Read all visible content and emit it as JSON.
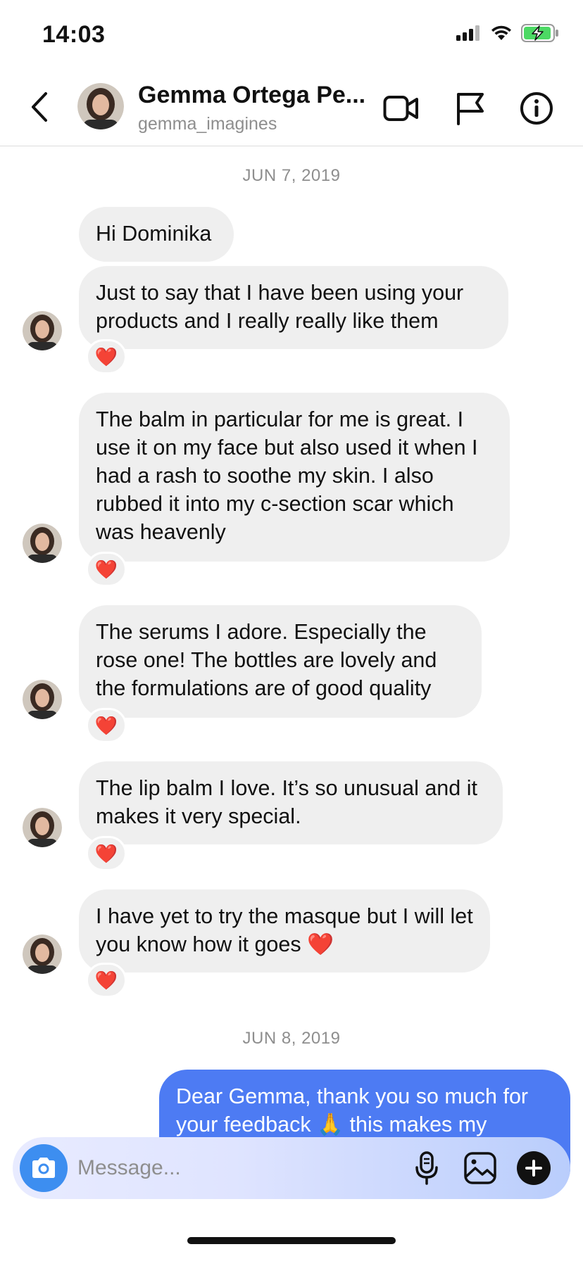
{
  "status_bar": {
    "time": "14:03"
  },
  "header": {
    "name": "Gemma Ortega Pe...",
    "username": "gemma_imagines"
  },
  "thread": {
    "date_1": "JUN 7, 2019",
    "date_2": "JUN 8, 2019",
    "messages": [
      {
        "text": "Hi Dominika"
      },
      {
        "text": "Just to say that I have been using your products and I really really like them",
        "reaction": "❤️"
      },
      {
        "text": "The balm in particular for me is great. I use it on my face but also used it when I had a rash to soothe my skin. I also rubbed it into my c-section scar which was heavenly",
        "reaction": "❤️"
      },
      {
        "text": "The serums I adore. Especially the rose one! The bottles are lovely and the formulations are of good quality",
        "reaction": "❤️"
      },
      {
        "text": "The lip balm I love. It’s so unusual and it makes it very special.",
        "reaction": "❤️"
      },
      {
        "text": "I have yet to try the masque but I will let you know how it goes ❤️",
        "reaction": "❤️"
      }
    ],
    "outgoing": [
      {
        "text": "Dear Gemma, thank you so much for your feedback 🙏 this makes my"
      }
    ]
  },
  "composer": {
    "placeholder": "Message..."
  },
  "colors": {
    "incoming_bubble": "#efefef",
    "outgoing_bubble": "#4d7bf3",
    "camera_button": "#3d8ef0",
    "battery": "#4cd964"
  },
  "icons": [
    "back-chevron-icon",
    "video-call-icon",
    "flag-icon",
    "info-icon",
    "camera-icon",
    "microphone-icon",
    "gallery-icon",
    "plus-icon"
  ]
}
